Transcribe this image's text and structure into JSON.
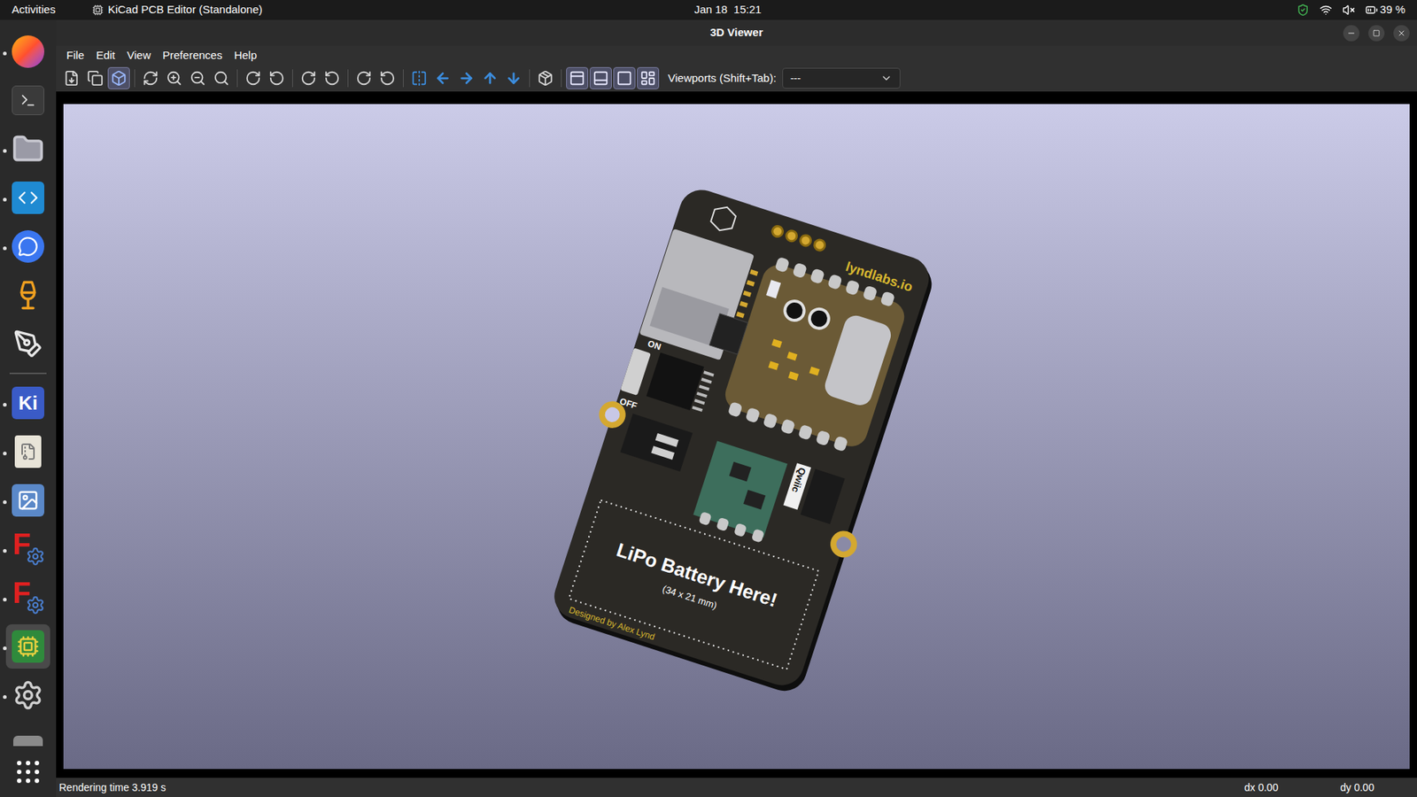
{
  "topbar": {
    "activities": "Activities",
    "app": "KiCad PCB Editor (Standalone)",
    "clock": "Jan 18  15:21",
    "battery": "39 %"
  },
  "dock": [
    {
      "kind": "firefox",
      "running": true,
      "selected": false
    },
    {
      "kind": "terminal",
      "running": false,
      "selected": false
    },
    {
      "kind": "files",
      "running": true,
      "selected": false
    },
    {
      "kind": "vscode",
      "running": true,
      "selected": false
    },
    {
      "kind": "signal",
      "running": true,
      "selected": false
    },
    {
      "kind": "cocktail",
      "running": false,
      "selected": false
    },
    {
      "kind": "inkscape",
      "running": false,
      "selected": false
    },
    {
      "kind": "separator",
      "running": false,
      "selected": false
    },
    {
      "kind": "kicad",
      "text": "Ki",
      "running": true,
      "selected": false
    },
    {
      "kind": "archive",
      "running": true,
      "selected": false
    },
    {
      "kind": "image-viewer",
      "running": true,
      "selected": false
    },
    {
      "kind": "freecad",
      "text": "F",
      "running": true,
      "selected": false
    },
    {
      "kind": "freecad",
      "text": "F",
      "running": true,
      "selected": false
    },
    {
      "kind": "pcb",
      "running": true,
      "selected": true
    },
    {
      "kind": "settings",
      "running": true,
      "selected": false
    },
    {
      "kind": "drive",
      "running": false,
      "selected": false
    },
    {
      "kind": "apps",
      "running": false,
      "selected": false
    }
  ],
  "window": {
    "title": "3D Viewer"
  },
  "menu": [
    "File",
    "Edit",
    "View",
    "Preferences",
    "Help"
  ],
  "toolbar": [
    {
      "kind": "export",
      "selected": false
    },
    {
      "kind": "copy",
      "selected": false
    },
    {
      "kind": "view3d",
      "selected": true
    },
    {
      "kind": "separator",
      "selected": false
    },
    {
      "kind": "reload",
      "selected": false
    },
    {
      "kind": "zoom-in",
      "selected": false
    },
    {
      "kind": "zoom-out",
      "selected": false
    },
    {
      "kind": "zoom-fit",
      "selected": false
    },
    {
      "kind": "separator",
      "selected": false
    },
    {
      "kind": "rot-x-cw",
      "selected": false
    },
    {
      "kind": "rot-x-ccw",
      "selected": false
    },
    {
      "kind": "separator",
      "selected": false
    },
    {
      "kind": "rot-y-cw",
      "selected": false
    },
    {
      "kind": "rot-y-ccw",
      "selected": false
    },
    {
      "kind": "separator",
      "selected": false
    },
    {
      "kind": "rot-z-cw",
      "selected": false
    },
    {
      "kind": "rot-z-ccw",
      "selected": false
    },
    {
      "kind": "separator",
      "selected": false
    },
    {
      "kind": "flip",
      "selected": false
    },
    {
      "kind": "left",
      "selected": false
    },
    {
      "kind": "right",
      "selected": false
    },
    {
      "kind": "up",
      "selected": false
    },
    {
      "kind": "down",
      "selected": false
    },
    {
      "kind": "separator",
      "selected": false
    },
    {
      "kind": "ortho",
      "selected": false
    },
    {
      "kind": "separator",
      "selected": false
    },
    {
      "kind": "layer-a",
      "selected": true
    },
    {
      "kind": "layer-b",
      "selected": true
    },
    {
      "kind": "layer-c",
      "selected": true
    },
    {
      "kind": "layer-d",
      "selected": true
    }
  ],
  "viewports": {
    "label": "Viewports (Shift+Tab):",
    "value": "---"
  },
  "board": {
    "brand": "lyndlabs.io",
    "switch_on": "ON",
    "switch_off": "OFF",
    "qwiic": "Qwiic",
    "battery_title": "LiPo Battery Here!",
    "battery_size": "(34 x 21 mm)",
    "credit": "Designed by Alex Lynd"
  },
  "status_bar": {
    "message": "Rendering time 3.919 s",
    "dx": "dx 0.00",
    "dy": "dy 0.00"
  }
}
